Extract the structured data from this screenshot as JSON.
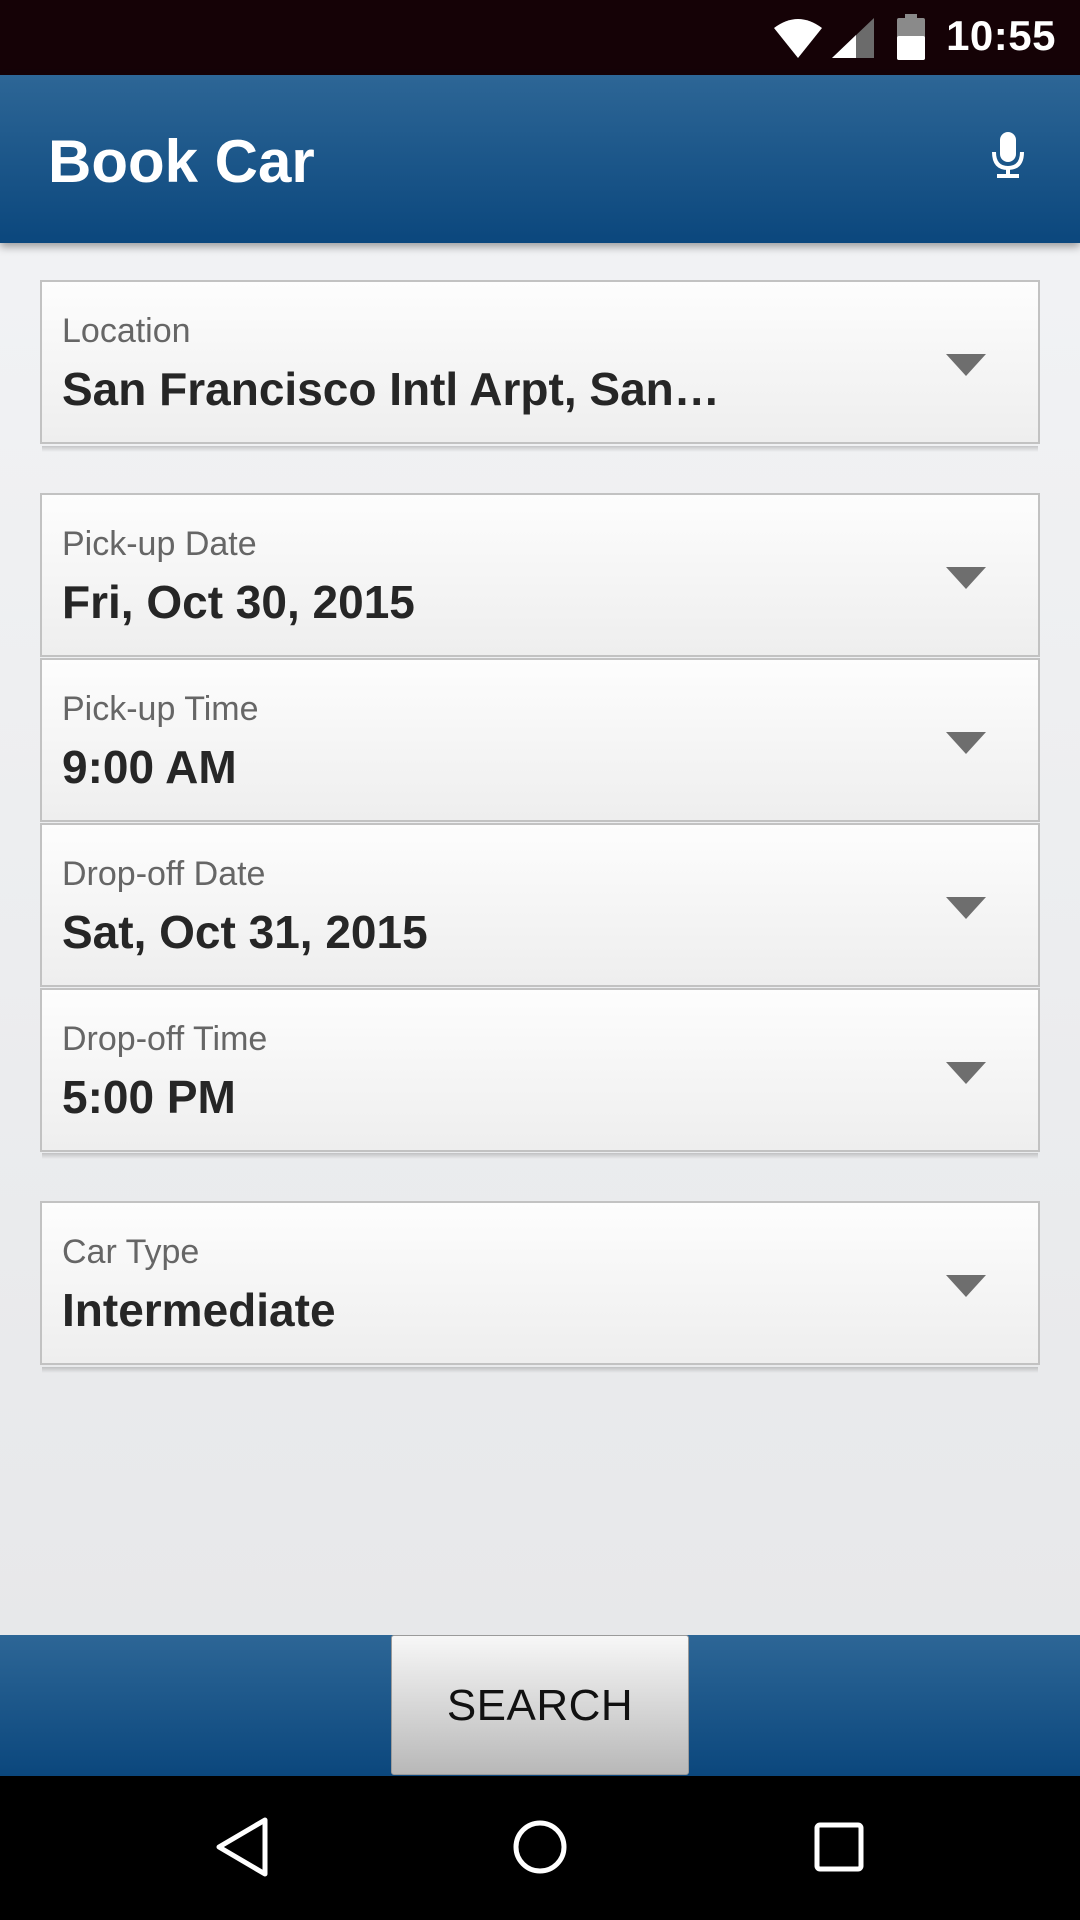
{
  "status_bar": {
    "time": "10:55",
    "icons": [
      "wifi-icon",
      "cell-signal-icon",
      "battery-icon"
    ]
  },
  "app_bar": {
    "title": "Book Car",
    "action_icon": "microphone-icon"
  },
  "form": {
    "location": {
      "label": "Location",
      "value": "San Francisco Intl Arpt, San…"
    },
    "pickup_date": {
      "label": "Pick-up Date",
      "value": "Fri, Oct 30, 2015"
    },
    "pickup_time": {
      "label": "Pick-up Time",
      "value": "9:00 AM"
    },
    "dropoff_date": {
      "label": "Drop-off Date",
      "value": "Sat, Oct 31, 2015"
    },
    "dropoff_time": {
      "label": "Drop-off Time",
      "value": "5:00 PM"
    },
    "car_type": {
      "label": "Car Type",
      "value": "Intermediate"
    }
  },
  "actions": {
    "search_label": "SEARCH"
  },
  "nav_bar": {
    "icons": [
      "back-icon",
      "home-icon",
      "recents-icon"
    ]
  },
  "colors": {
    "app_bar": "#1f5a8c",
    "status_bar": "#150206",
    "background": "#eceded"
  }
}
